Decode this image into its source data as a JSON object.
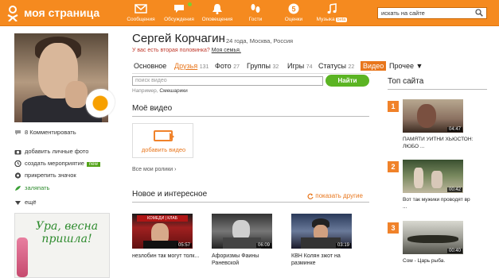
{
  "header": {
    "title": "моя страница",
    "nav": [
      {
        "label": "Сообщения",
        "icon": "envelope-icon"
      },
      {
        "label": "Обсуждения",
        "icon": "chat-icon"
      },
      {
        "label": "Оповещения",
        "icon": "bell-icon"
      },
      {
        "label": "Гости",
        "icon": "footprints-icon"
      },
      {
        "label": "Оценки",
        "icon": "rating-5-icon",
        "badge": "5"
      },
      {
        "label": "Музыка",
        "icon": "music-note-icon",
        "beta": "beta"
      }
    ],
    "search_value": "искать на сайте"
  },
  "profile": {
    "name": "Сергей Корчагин",
    "meta": "24 года, Москва, Россия",
    "half_q": "У вас есть вторая половинка?",
    "half_link": "Моя семья.",
    "comments": "8 Комментировать",
    "side_links": [
      {
        "label": "добавить личные фото",
        "icon": "camera-icon"
      },
      {
        "label": "создать мероприятие",
        "icon": "calendar-icon",
        "badge": "new"
      },
      {
        "label": "прикрепить значок",
        "icon": "badge-icon"
      },
      {
        "label": "заляпать",
        "icon": "paint-icon"
      },
      {
        "label": "ещё",
        "icon": "triangle-down-icon"
      }
    ],
    "promo_text": "Ура, весна пришла!"
  },
  "tabs": [
    {
      "label": "Основное",
      "count": ""
    },
    {
      "label": "Друзья",
      "count": "131"
    },
    {
      "label": "Фото",
      "count": "27"
    },
    {
      "label": "Группы",
      "count": "32"
    },
    {
      "label": "Игры",
      "count": "74"
    },
    {
      "label": "Статусы",
      "count": "22"
    },
    {
      "label": "Видео",
      "count": ""
    },
    {
      "label": "Прочее ▼",
      "count": ""
    }
  ],
  "video_search": {
    "placeholder": "поиск видео",
    "button": "Найти",
    "example_label": "Например,",
    "example_value": "Смешарики"
  },
  "my_video": {
    "title": "Моё видео",
    "add_label": "добавить видео",
    "all_link": "Все мои ролики ›"
  },
  "news": {
    "title": "Новое и интересное",
    "more": "показать другие",
    "items": [
      {
        "caption": "незлобин так могут толк...",
        "duration": "05:57",
        "overlay": "КОМЕДИ | КЛАБ"
      },
      {
        "caption": "Афоризмы Фаины Раневской",
        "duration": "06:09"
      },
      {
        "caption": "КВН Колян зжот на разминке",
        "duration": "03:19"
      }
    ]
  },
  "top": {
    "title": "Топ сайта",
    "items": [
      {
        "rank": "1",
        "caption": "ПАМЯТИ УИТНИ ХЬЮСТОН: ЛЮБО ...",
        "duration": "04:47"
      },
      {
        "rank": "2",
        "caption": "Вот так мужики проводят вр ...",
        "duration": "00:42"
      },
      {
        "rank": "3",
        "caption": "Сом - Царь рыба.",
        "duration": "00:40"
      }
    ]
  },
  "colors": {
    "brand": "#f58a1f",
    "accent": "#e8761c",
    "button_green": "#5bb423"
  }
}
